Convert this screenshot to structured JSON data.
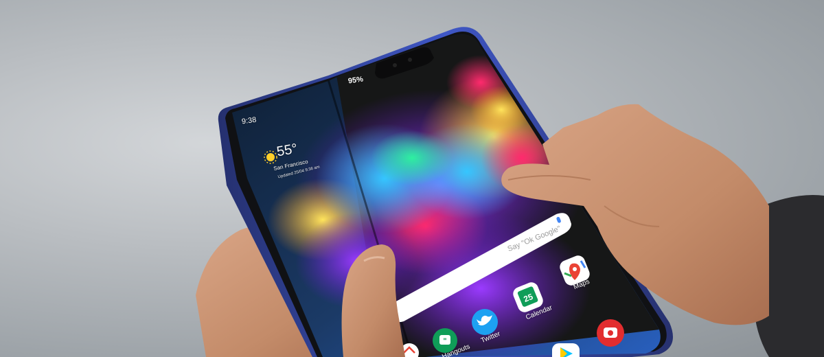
{
  "status_bar": {
    "time": "9:38",
    "battery": "95%"
  },
  "weather_widget": {
    "temperature": "55°",
    "city": "San Francisco",
    "updated": "Updated 25/04 9:36 am"
  },
  "search_bar": {
    "hint": "Say \"Ok Google\""
  },
  "apps": [
    {
      "label": "Maps",
      "icon": "maps-icon"
    },
    {
      "label": "Calendar",
      "icon": "calendar-icon",
      "badge": "25"
    },
    {
      "label": "Twitter",
      "icon": "twitter-icon"
    },
    {
      "label": "Hangouts",
      "icon": "hangouts-icon"
    },
    {
      "label": "",
      "icon": "camera-icon"
    },
    {
      "label": "",
      "icon": "play-store-icon"
    },
    {
      "label": "",
      "icon": "gmail-icon"
    }
  ],
  "colors": {
    "background": "#b9bdc1",
    "phone_frame": "#2f3a8f",
    "bezel": "#101114",
    "skin": "#c9926f",
    "sleeve": "#2b2b2e"
  }
}
